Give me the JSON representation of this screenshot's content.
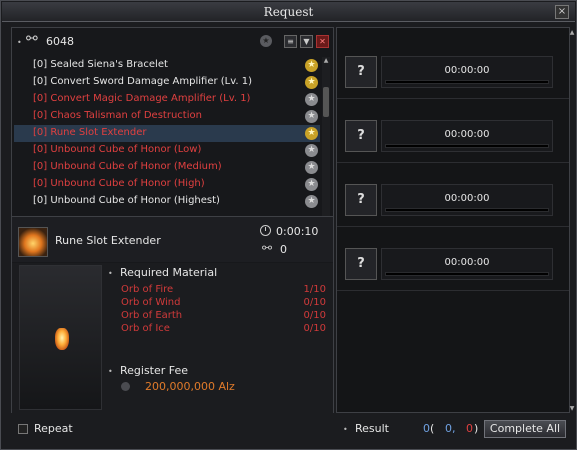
{
  "window": {
    "title": "Request",
    "close_label": "×"
  },
  "list": {
    "count": "6048",
    "items": [
      {
        "label": "[0] Sealed Siena's Bracelet",
        "color": "white",
        "star": "gold"
      },
      {
        "label": "[0] Convert Sword Damage Amplifier (Lv. 1)",
        "color": "white",
        "star": "gold"
      },
      {
        "label": "[0] Convert Magic Damage Amplifier (Lv. 1)",
        "color": "red",
        "star": "grey"
      },
      {
        "label": "[0] Chaos Talisman of Destruction",
        "color": "red",
        "star": "grey"
      },
      {
        "label": "[0] Rune Slot Extender",
        "color": "red",
        "star": "gold",
        "selected": true
      },
      {
        "label": "[0] Unbound Cube of Honor (Low)",
        "color": "red",
        "star": "grey"
      },
      {
        "label": "[0] Unbound Cube of Honor (Medium)",
        "color": "red",
        "star": "grey"
      },
      {
        "label": "[0] Unbound Cube of Honor (High)",
        "color": "red",
        "star": "grey"
      },
      {
        "label": "[0] Unbound Cube of Honor (Highest)",
        "color": "white",
        "star": "grey"
      }
    ]
  },
  "detail": {
    "item_name": "Rune Slot Extender",
    "time": "0:00:10",
    "link_count": "0",
    "required_material_label": "Required Material",
    "materials": [
      {
        "name": "Orb of Fire",
        "qty": "1/10"
      },
      {
        "name": "Orb of Wind",
        "qty": "0/10"
      },
      {
        "name": "Orb of Earth",
        "qty": "0/10"
      },
      {
        "name": "Orb of Ice",
        "qty": "0/10"
      }
    ],
    "register_fee_label": "Register Fee",
    "fee": "200,000,000 Alz"
  },
  "repeat_label": "Repeat",
  "slots": [
    {
      "icon": "?",
      "time": "00:00:00"
    },
    {
      "icon": "?",
      "time": "00:00:00"
    },
    {
      "icon": "?",
      "time": "00:00:00"
    },
    {
      "icon": "?",
      "time": "00:00:00"
    }
  ],
  "result": {
    "label": "Result",
    "v1": "0",
    "open": "(",
    "v2": "0,",
    "v3": "0",
    "close": ")",
    "complete_label": "Complete All"
  },
  "colors": {
    "red_text": "#d03a3a",
    "fee": "#e07a2a",
    "gold_star": "#c9a227",
    "blue_num": "#6fa0e0"
  }
}
